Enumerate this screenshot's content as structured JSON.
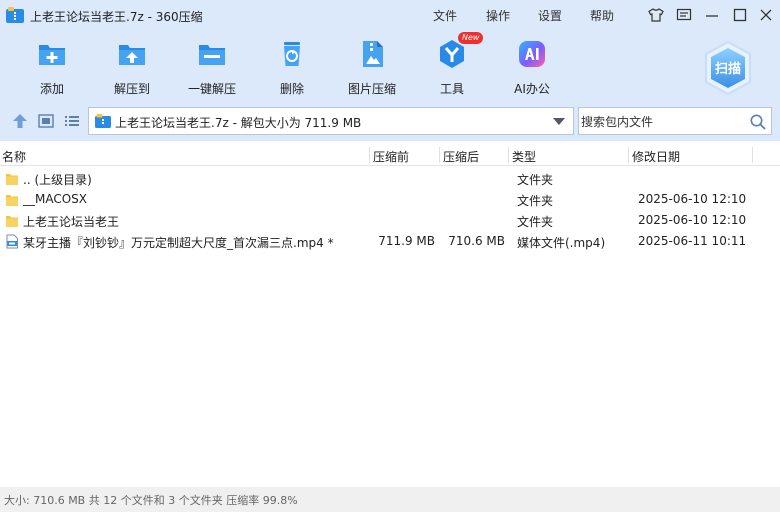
{
  "window": {
    "title": "上老王论坛当老王.7z - 360压缩",
    "menu": [
      "文件",
      "操作",
      "设置",
      "帮助"
    ],
    "icons": [
      "tshirt-icon",
      "feedback-icon",
      "minimize-icon",
      "maximize-icon",
      "close-icon"
    ]
  },
  "toolbar": {
    "items": [
      {
        "label": "添加",
        "icon": "add-archive-icon"
      },
      {
        "label": "解压到",
        "icon": "extract-to-icon"
      },
      {
        "label": "一键解压",
        "icon": "one-click-extract-icon"
      },
      {
        "label": "删除",
        "icon": "delete-icon"
      },
      {
        "label": "图片压缩",
        "icon": "image-compress-icon"
      },
      {
        "label": "工具",
        "icon": "tools-icon",
        "badge": "New"
      },
      {
        "label": "AI办公",
        "icon": "ai-office-icon"
      }
    ],
    "scan_label": "扫描"
  },
  "addressbar": {
    "path": "上老王论坛当老王.7z - 解包大小为 711.9 MB",
    "search_placeholder": "搜索包内文件"
  },
  "columns": {
    "name": "名称",
    "packed": "压缩前",
    "size": "压缩后",
    "type": "类型",
    "modified": "修改日期"
  },
  "files": [
    {
      "name": ".. (上级目录)",
      "packed": "",
      "size": "",
      "type": "文件夹",
      "modified": "",
      "icon": "folder-icon"
    },
    {
      "name": "__MACOSX",
      "packed": "",
      "size": "",
      "type": "文件夹",
      "modified": "2025-06-10 12:10",
      "icon": "folder-icon"
    },
    {
      "name": "上老王论坛当老王",
      "packed": "",
      "size": "",
      "type": "文件夹",
      "modified": "2025-06-10 12:10",
      "icon": "folder-icon"
    },
    {
      "name": "某牙主播『刘钞钞』万元定制超大尺度_首次漏三点.mp4 *",
      "packed": "711.9 MB",
      "size": "710.6 MB",
      "type": "媒体文件(.mp4)",
      "modified": "2025-06-11 10:11",
      "icon": "mp4-file-icon"
    }
  ],
  "status": "大小: 710.6 MB 共 12 个文件和 3 个文件夹 压缩率 99.8%",
  "colors": {
    "chrome": "#dbe9fb",
    "accent": "#2a8be6",
    "folder": "#f5c43b"
  }
}
